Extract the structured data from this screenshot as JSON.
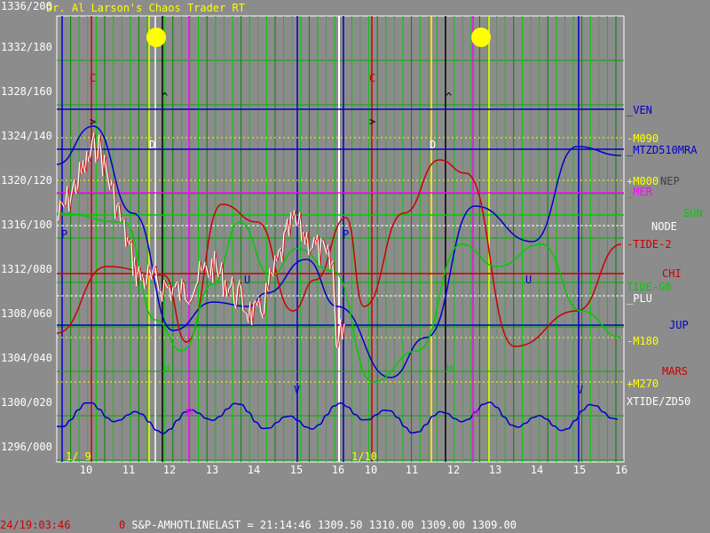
{
  "title": "Dr. Al Larson's Chaos Trader RT",
  "y_axis_labels": [
    "1336/200",
    "1332/180",
    "1328/160",
    "1324/140",
    "1320/120",
    "1316/100",
    "1312/080",
    "1308/060",
    "1304/040",
    "1300/020",
    "1296/000"
  ],
  "x_axis_labels": [
    "10",
    "11",
    "12",
    "13",
    "14",
    "15",
    "16",
    "10",
    "11",
    "12",
    "13",
    "14",
    "15",
    "16"
  ],
  "date_labels": [
    "1/ 9",
    "1/10"
  ],
  "right_labels": [
    {
      "text": "_VEN",
      "color": "#0000cc"
    },
    {
      "text": "-M090",
      "color": "#ffff00"
    },
    {
      "text": "_MTZD510MRA",
      "color": "#0000cc"
    },
    {
      "text": "+M000",
      "color": "#ffff00"
    },
    {
      "text": "NEP",
      "color": "#404040"
    },
    {
      "text": "_MER",
      "color": "#ff00ff"
    },
    {
      "text": "SUN",
      "color": "#00cc00"
    },
    {
      "text": "NODE",
      "color": "#ffffff"
    },
    {
      "text": "-TIDE-2",
      "color": "#cc0000"
    },
    {
      "text": "CHI",
      "color": "#cc0000"
    },
    {
      "text": "TIDE-G8",
      "color": "#00cc00"
    },
    {
      "text": "_PLU",
      "color": "#ffffff"
    },
    {
      "text": "JUP",
      "color": "#0000cc"
    },
    {
      "text": "-M180",
      "color": "#ffff00"
    },
    {
      "text": "MARS",
      "color": "#cc0000"
    },
    {
      "text": "+M270",
      "color": "#ffff00"
    },
    {
      "text": "XTIDE/ZD50",
      "color": "#ffffff"
    }
  ],
  "markers": {
    "C": "C",
    "D": "D",
    "P": "P",
    "U": "U",
    "V": "V",
    "H": "H",
    "M": "M",
    "caret": "^",
    "gt": ">"
  },
  "status": {
    "time": "24/19:03:46",
    "zero": "0",
    "feed": "S&P-AMHOTLINE",
    "last_label": "LAST = ",
    "last_time": "21:14:46",
    "open": "1309.50",
    "high": "1310.00",
    "low": "1309.00",
    "close": "1309.00"
  },
  "colors": {
    "background": "#8c8c8c",
    "blue": "#0000cc",
    "red": "#cc0000",
    "green": "#00cc00",
    "yellow": "#ffff00",
    "magenta": "#ff00ff",
    "white": "#ffffff"
  }
}
